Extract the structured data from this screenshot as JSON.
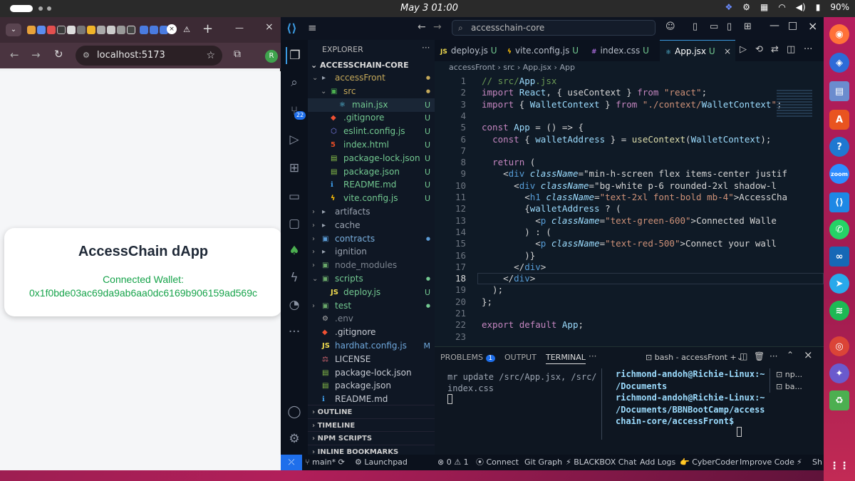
{
  "system_bar": {
    "clock": "May 3  01:00",
    "battery": "90%"
  },
  "browser": {
    "url": "localhost:5173",
    "avatar_initial": "R",
    "card": {
      "title": "AccessChain dApp",
      "status_label": "Connected Wallet:",
      "address": "0x1f0bde03ac69da9ab6aa0dc6169b906159ad569c"
    }
  },
  "vscode": {
    "command_center": "accesschain-core",
    "explorer_title": "EXPLORER",
    "project_name": "ACCESSCHAIN-CORE",
    "tree": [
      {
        "label": "accessFront",
        "icon": "folder",
        "indent": 1,
        "chev": "v",
        "status": "dot-yellow",
        "color": "#c5a95a"
      },
      {
        "label": "src",
        "icon": "folder-src",
        "indent": 2,
        "chev": "v",
        "status": "dot-yellow",
        "color": "#c5a95a"
      },
      {
        "label": "main.jsx",
        "icon": "react",
        "indent": 3,
        "chev": "",
        "status": "U",
        "color": "#73c991"
      },
      {
        "label": ".gitignore",
        "icon": "git",
        "indent": 2,
        "chev": "",
        "status": "U",
        "color": "#73c991"
      },
      {
        "label": "eslint.config.js",
        "icon": "eslint",
        "indent": 2,
        "chev": "",
        "status": "U",
        "color": "#73c991"
      },
      {
        "label": "index.html",
        "icon": "html",
        "indent": 2,
        "chev": "",
        "status": "U",
        "color": "#73c991"
      },
      {
        "label": "package-lock.json",
        "icon": "npm",
        "indent": 2,
        "chev": "",
        "status": "U",
        "color": "#73c991"
      },
      {
        "label": "package.json",
        "icon": "npm",
        "indent": 2,
        "chev": "",
        "status": "U",
        "color": "#73c991"
      },
      {
        "label": "README.md",
        "icon": "info",
        "indent": 2,
        "chev": "",
        "status": "U",
        "color": "#73c991"
      },
      {
        "label": "vite.config.js",
        "icon": "vite",
        "indent": 2,
        "chev": "",
        "status": "U",
        "color": "#73c991"
      },
      {
        "label": "artifacts",
        "icon": "folder",
        "indent": 1,
        "chev": ">",
        "status": "",
        "color": "#9aa3b0"
      },
      {
        "label": "cache",
        "icon": "folder",
        "indent": 1,
        "chev": ">",
        "status": "",
        "color": "#9aa3b0"
      },
      {
        "label": "contracts",
        "icon": "folder-blue",
        "indent": 1,
        "chev": ">",
        "status": "dot-blue",
        "color": "#7ab0df"
      },
      {
        "label": "ignition",
        "icon": "folder",
        "indent": 1,
        "chev": ">",
        "status": "",
        "color": "#9aa3b0"
      },
      {
        "label": "node_modules",
        "icon": "folder-green",
        "indent": 1,
        "chev": ">",
        "status": "",
        "color": "#7d8590"
      },
      {
        "label": "scripts",
        "icon": "folder-green",
        "indent": 1,
        "chev": "v",
        "status": "dot-green",
        "color": "#73c991"
      },
      {
        "label": "deploy.js",
        "icon": "js",
        "indent": 2,
        "chev": "",
        "status": "U",
        "color": "#73c991"
      },
      {
        "label": "test",
        "icon": "folder-green",
        "indent": 1,
        "chev": ">",
        "status": "dot-green",
        "color": "#73c991"
      },
      {
        "label": ".env",
        "icon": "env",
        "indent": 1,
        "chev": "",
        "status": "",
        "color": "#7d8590"
      },
      {
        "label": ".gitignore",
        "icon": "git",
        "indent": 1,
        "chev": "",
        "status": "",
        "color": "#c8ccd4"
      },
      {
        "label": "hardhat.config.js",
        "icon": "js",
        "indent": 1,
        "chev": "",
        "status": "M",
        "color": "#6fa8dc"
      },
      {
        "label": "LICENSE",
        "icon": "license",
        "indent": 1,
        "chev": "",
        "status": "",
        "color": "#c8ccd4"
      },
      {
        "label": "package-lock.json",
        "icon": "npm",
        "indent": 1,
        "chev": "",
        "status": "",
        "color": "#c8ccd4"
      },
      {
        "label": "package.json",
        "icon": "npm",
        "indent": 1,
        "chev": "",
        "status": "",
        "color": "#c8ccd4"
      },
      {
        "label": "README.md",
        "icon": "info",
        "indent": 1,
        "chev": "",
        "status": "",
        "color": "#c8ccd4"
      }
    ],
    "sections": [
      "OUTLINE",
      "TIMELINE",
      "NPM SCRIPTS",
      "INLINE BOOKMARKS"
    ],
    "editor_tabs": [
      {
        "label": "deploy.js",
        "status": "U",
        "icon": "js"
      },
      {
        "label": "vite.config.js",
        "status": "U",
        "icon": "vite"
      },
      {
        "label": "index.css",
        "status": "U",
        "icon": "css"
      },
      {
        "label": "App.jsx",
        "status": "U",
        "icon": "react",
        "active": true
      }
    ],
    "breadcrumb": [
      "accessFront",
      "src",
      "App.jsx",
      "App"
    ],
    "line_numbers": [
      "1",
      "2",
      "3",
      "4",
      "5",
      "6",
      "7",
      "8",
      "9",
      "10",
      "11",
      "12",
      "13",
      "14",
      "15",
      "16",
      "17",
      "18",
      "19",
      "20",
      "21",
      "22",
      "23"
    ],
    "code_text": {
      "l1": "// src/App.jsx",
      "l2": "import React, { useContext } from \"react\";",
      "l3": "import { WalletContext } from \"./context/WalletContext\";",
      "l5": "const App = () => {",
      "l6": "  const { walletAddress } = useContext(WalletContext);",
      "l8": "  return (",
      "l9": "    <div className=\"min-h-screen flex items-center justif",
      "l10": "      <div className=\"bg-white p-6 rounded-2xl shadow-l",
      "l11": "        <h1 className=\"text-2xl font-bold mb-4\">AccessCha",
      "l12": "        {walletAddress ? (",
      "l13": "          <p className=\"text-green-600\">Connected Walle",
      "l14": "        ) : (",
      "l15": "          <p className=\"text-red-500\">Connect your wall",
      "l16": "        )}",
      "l17": "      </div>",
      "l18": "    </div>",
      "l19": "  );",
      "l20": "};",
      "l22": "export default App;"
    },
    "panel": {
      "tabs": [
        "PROBLEMS",
        "OUTPUT",
        "TERMINAL"
      ],
      "problems_count": "1",
      "terminal_name": "bash - accessFront",
      "left_output": [
        "mr update /src/App.jsx, /src/",
        "index.css"
      ],
      "prompt_lines": [
        "richmond-andoh@Richie-Linux:~",
        "/Documents",
        "richmond-andoh@Richie-Linux:~",
        "/Documents/BBNBootCamp/access",
        "chain-core/accessFront$"
      ],
      "terminal_list": [
        "np...",
        "ba..."
      ]
    },
    "status_bar": {
      "branch": "main*",
      "launchpad": "Launchpad",
      "errors": "0",
      "warnings": "1",
      "connect": "Connect",
      "git_graph": "Git Graph",
      "blackbox": "BLACKBOX Chat",
      "add_logs": "Add Logs",
      "cybercoder": "CyberCoder",
      "improve": "Improve Code",
      "share": "Sh"
    }
  },
  "colors": {
    "accent": "#007acc",
    "green": "#16a34a",
    "red": "#ef4444"
  }
}
